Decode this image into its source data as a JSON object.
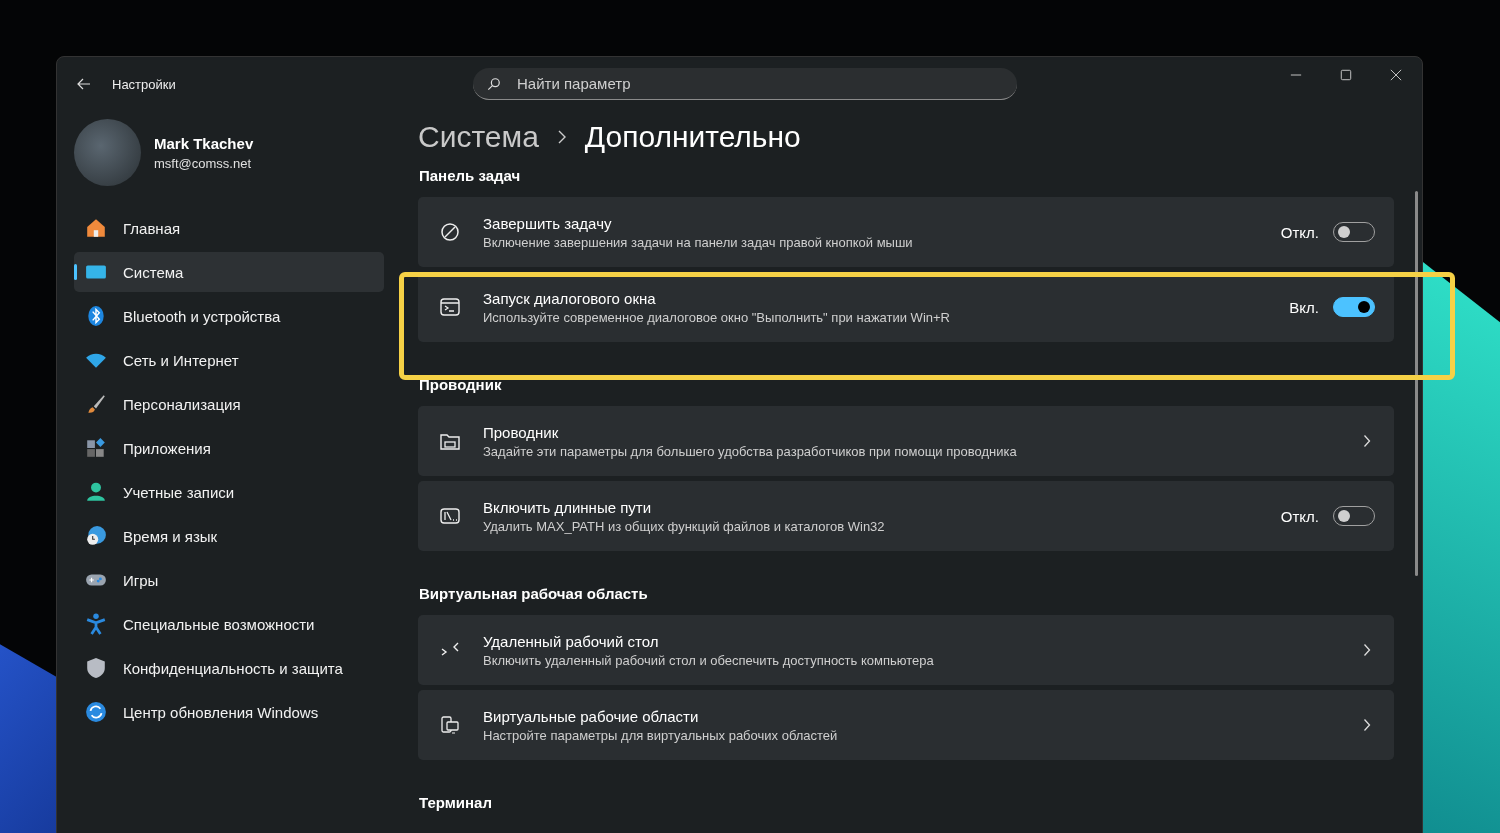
{
  "window": {
    "title": "Настройки"
  },
  "search": {
    "placeholder": "Найти параметр"
  },
  "account": {
    "name": "Mark Tkachev",
    "email": "msft@comss.net"
  },
  "nav": [
    {
      "label": "Главная",
      "selected": false
    },
    {
      "label": "Система",
      "selected": true
    },
    {
      "label": "Bluetooth и устройства",
      "selected": false
    },
    {
      "label": "Сеть и Интернет",
      "selected": false
    },
    {
      "label": "Персонализация",
      "selected": false
    },
    {
      "label": "Приложения",
      "selected": false
    },
    {
      "label": "Учетные записи",
      "selected": false
    },
    {
      "label": "Время и язык",
      "selected": false
    },
    {
      "label": "Игры",
      "selected": false
    },
    {
      "label": "Специальные возможности",
      "selected": false
    },
    {
      "label": "Конфиденциальность и защита",
      "selected": false
    },
    {
      "label": "Центр обновления Windows",
      "selected": false
    }
  ],
  "breadcrumb": [
    "Система",
    "Дополнительно"
  ],
  "sections": [
    {
      "title": "Панель задач",
      "rows": [
        {
          "kind": "toggle",
          "title": "Завершить задачу",
          "description": "Включение завершения задачи на панели задач правой кнопкой мыши",
          "state_label": "Откл.",
          "on": false
        },
        {
          "kind": "toggle",
          "title": "Запуск диалогового окна",
          "description": "Используйте современное диалоговое окно \"Выполнить\" при нажатии Win+R",
          "state_label": "Вкл.",
          "on": true
        }
      ]
    },
    {
      "title": "Проводник",
      "rows": [
        {
          "kind": "link",
          "title": "Проводник",
          "description": "Задайте эти параметры для большего удобства разработчиков при помощи проводника"
        },
        {
          "kind": "toggle",
          "title": "Включить длинные пути",
          "description": "Удалить MAX_PATH из общих функций файлов и каталогов Win32",
          "state_label": "Откл.",
          "on": false
        }
      ]
    },
    {
      "title": "Виртуальная рабочая область",
      "rows": [
        {
          "kind": "link",
          "title": "Удаленный рабочий стол",
          "description": "Включить удаленный рабочий стол и обеспечить доступность компьютера"
        },
        {
          "kind": "link",
          "title": "Виртуальные рабочие области",
          "description": "Настройте параметры для виртуальных рабочих областей"
        }
      ]
    },
    {
      "title": "Терминал"
    }
  ]
}
